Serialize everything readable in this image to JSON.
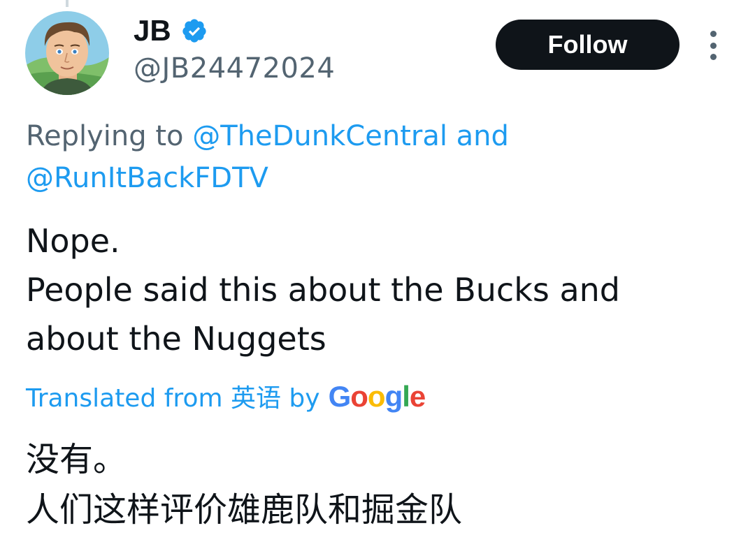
{
  "author": {
    "display_name": "JB",
    "handle": "@JB24472024",
    "avatar": "cartoon-man-avatar",
    "verified": true
  },
  "header": {
    "follow_label": "Follow",
    "more_icon": "more-vertical-icon"
  },
  "reply_context": {
    "prefix": "Replying to ",
    "mention_1": "@TheDunkCentral",
    "joiner": " and",
    "mention_2": "@RunItBackFDTV"
  },
  "tweet": {
    "lines": [
      "Nope.",
      "People said this about the Bucks and",
      "about the Nuggets"
    ]
  },
  "translation": {
    "label": "Translated from 英语 by",
    "provider": "Google",
    "lines": [
      "没有。",
      "人们这样评价雄鹿队和掘金队"
    ]
  },
  "colors": {
    "accent": "#1d9bf0",
    "text": "#0f1419",
    "secondary": "#536471",
    "button_bg": "#0f1419"
  }
}
